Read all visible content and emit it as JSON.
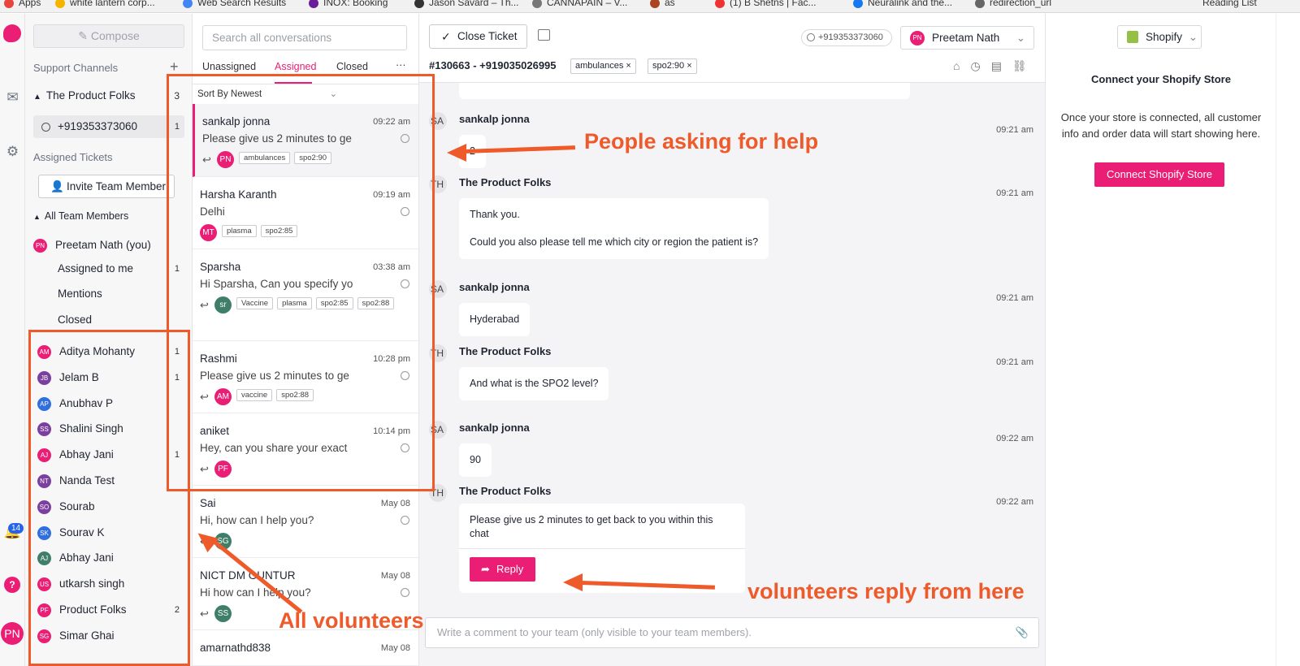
{
  "browser": {
    "bookmarks": [
      "Apps",
      "white lantern corp...",
      "Web Search Results",
      "INOX: Booking",
      "Jason Savard – Th...",
      "CANNAPAIN – V...",
      "as",
      "(1) B Shetns | Fac...",
      "Neuralink and the...",
      "redirection_url"
    ],
    "reading_list": "Reading List"
  },
  "rail": {
    "notifications_badge": "14",
    "help": "?",
    "user_initials": "PN"
  },
  "sidebar": {
    "compose_label": "Compose",
    "support_channels_heading": "Support Channels",
    "add": "+",
    "channel_group": {
      "label": "The Product Folks",
      "count": "3"
    },
    "channel": {
      "label": "+919353373060",
      "count": "1"
    },
    "assigned_heading": "Assigned Tickets",
    "invite_label": "Invite Team Member",
    "all_team_label": "All Team Members",
    "me": {
      "initials": "PN",
      "name": "Preetam Nath (you)"
    },
    "my_items": [
      {
        "label": "Assigned to me",
        "count": "1"
      },
      {
        "label": "Mentions",
        "count": ""
      },
      {
        "label": "Closed",
        "count": ""
      }
    ],
    "members": [
      {
        "initials": "AM",
        "name": "Aditya Mohanty",
        "count": "1",
        "color": "#e91e74"
      },
      {
        "initials": "JB",
        "name": "Jelam B",
        "count": "1",
        "color": "#7b3fa0"
      },
      {
        "initials": "AP",
        "name": "Anubhav P",
        "count": "",
        "color": "#2f6fdf"
      },
      {
        "initials": "SS",
        "name": "Shalini Singh",
        "count": "",
        "color": "#7b3fa0"
      },
      {
        "initials": "AJ",
        "name": "Abhay Jani",
        "count": "1",
        "color": "#e91e74"
      },
      {
        "initials": "NT",
        "name": "Nanda Test",
        "count": "",
        "color": "#7b3fa0"
      },
      {
        "initials": "SO",
        "name": "Sourab",
        "count": "",
        "color": "#7b3fa0"
      },
      {
        "initials": "SK",
        "name": "Sourav K",
        "count": "",
        "color": "#2f6fdf"
      },
      {
        "initials": "AJ",
        "name": "Abhay Jani",
        "count": "",
        "color": "#3f7f6a"
      },
      {
        "initials": "US",
        "name": "utkarsh singh",
        "count": "",
        "color": "#e91e74"
      },
      {
        "initials": "PF",
        "name": "Product Folks",
        "count": "2",
        "color": "#e91e74"
      },
      {
        "initials": "SG",
        "name": "Simar Ghai",
        "count": "",
        "color": "#e91e74"
      }
    ]
  },
  "convlist": {
    "search_placeholder": "Search all conversations",
    "tabs": [
      "Unassigned",
      "Assigned",
      "Closed"
    ],
    "more": "···",
    "sort_label": "Sort By Newest",
    "items": [
      {
        "name": "sankalp jonna",
        "time": "09:22 am",
        "msg": "Please give us 2 minutes to ge",
        "initials": "PN",
        "color": "#e91e74",
        "reply": true,
        "tags": [
          "ambulances",
          "spo2:90"
        ]
      },
      {
        "name": "Harsha Karanth",
        "time": "09:19 am",
        "msg": "Delhi",
        "initials": "MT",
        "color": "#e91e74",
        "reply": false,
        "tags": [
          "plasma",
          "spo2:85"
        ]
      },
      {
        "name": "Sparsha",
        "time": "03:38 am",
        "msg": "Hi Sparsha, Can you specify yo",
        "initials": "sr",
        "color": "#3f7f6a",
        "reply": true,
        "tags": [
          "Vaccine",
          "plasma",
          "spo2:85",
          "spo2:88"
        ]
      },
      {
        "name": "Rashmi",
        "time": "10:28 pm",
        "msg": "Please give us 2 minutes to ge",
        "initials": "AM",
        "color": "#e91e74",
        "reply": true,
        "tags": [
          "vaccine",
          "spo2:88"
        ]
      },
      {
        "name": "aniket",
        "time": "10:14 pm",
        "msg": "Hey, can you share your exact",
        "initials": "PF",
        "color": "#e91e74",
        "reply": true,
        "tags": []
      },
      {
        "name": "Sai",
        "time": "May 08",
        "msg": "Hi, how can I help you?",
        "initials": "SG",
        "color": "#3f7f6a",
        "reply": true,
        "tags": []
      },
      {
        "name": "NICT DM GUNTUR",
        "time": "May 08",
        "msg": "Hi how can I help you?",
        "initials": "SS",
        "color": "#3f7f6a",
        "reply": true,
        "tags": []
      },
      {
        "name": "amarnathd838",
        "time": "May 08",
        "msg": "",
        "initials": "",
        "color": "#3f7f6a",
        "reply": false,
        "tags": []
      }
    ]
  },
  "chat": {
    "close_label": "Close Ticket",
    "phone": "+919353373060",
    "agent_initials": "PN",
    "agent_name": "Preetam Nath",
    "ticket_id": "#130663 - +919035026995",
    "ticket_tags": [
      "ambulances",
      "spo2:90"
    ],
    "messages": [
      {
        "av": "SA",
        "name": "sankalp jonna",
        "time": "09:21 am",
        "lines": [
          "2"
        ]
      },
      {
        "av": "TH",
        "name": "The Product Folks",
        "time": "09:21 am",
        "lines": [
          "Thank you.",
          "",
          "Could you also please tell me which city or region the patient is?"
        ]
      },
      {
        "av": "SA",
        "name": "sankalp jonna",
        "time": "09:21 am",
        "lines": [
          "Hyderabad"
        ]
      },
      {
        "av": "TH",
        "name": "The Product Folks",
        "time": "09:21 am",
        "lines": [
          "And what is the SPO2 level?"
        ]
      },
      {
        "av": "SA",
        "name": "sankalp jonna",
        "time": "09:22 am",
        "lines": [
          "90"
        ]
      },
      {
        "av": "TH",
        "name": "The Product Folks",
        "time": "09:22 am",
        "lines": [
          "Please give us 2 minutes to get back to you within this chat"
        ]
      }
    ],
    "reply_label": "Reply",
    "comment_placeholder": "Write a comment to your team (only visible to your team members)."
  },
  "shopify": {
    "selector": "Shopify",
    "title": "Connect your Shopify Store",
    "text": "Once your store is connected, all customer info and order data will start showing here.",
    "button": "Connect Shopify Store"
  },
  "annotations": {
    "people": "People asking for help",
    "volunteers": "All volunteers",
    "reply": "volunteers reply from here"
  }
}
